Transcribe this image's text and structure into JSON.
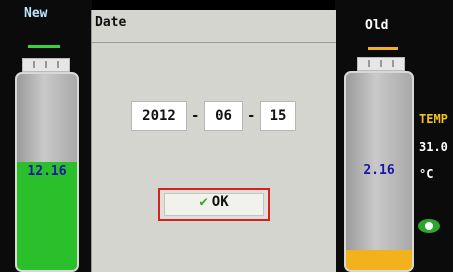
{
  "left": {
    "label": "New",
    "value": "12.16",
    "fill_fraction": 0.55,
    "fill_color": "#2bbf2b",
    "accent": "#39d339"
  },
  "right": {
    "label": "Old",
    "value": "2.16",
    "fill_fraction": 0.1,
    "fill_color": "#f2b21c",
    "accent": "#f2b21c"
  },
  "dialog": {
    "title": "Date",
    "year": "2012",
    "month": "06",
    "day": "15",
    "separator": "-",
    "ok_label": "OK"
  },
  "side": {
    "temp_label": "TEMP",
    "temp_value": "31.0",
    "unit": "°C",
    "temp_color": "#f2c31c"
  },
  "icons": {
    "ok": "checkmark-icon",
    "eye": "eye-icon"
  }
}
